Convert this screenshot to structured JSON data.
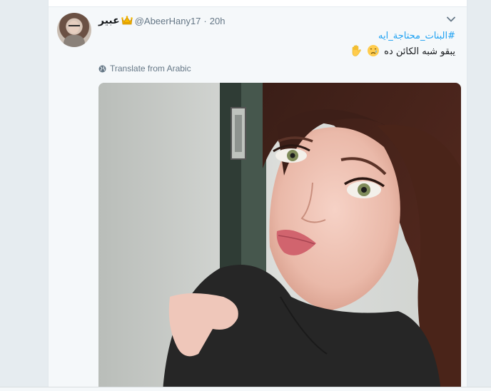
{
  "tweet": {
    "display_name": "عبير",
    "handle": "@AbeerHany17",
    "separator": "·",
    "time": "20h",
    "hashtag": "#البنات_محتاجة_ايه",
    "body": "يبقو شبه الكائن ده",
    "translate_label": "Translate from Arabic",
    "icons": [
      "crown-icon",
      "crying-face-emoji",
      "raised-hand-emoji",
      "globe-icon",
      "chevron-down-icon"
    ]
  },
  "colors": {
    "link": "#1da1f2",
    "meta": "#657786",
    "text": "#14171a",
    "tweet_bg": "#f5f8fa"
  }
}
